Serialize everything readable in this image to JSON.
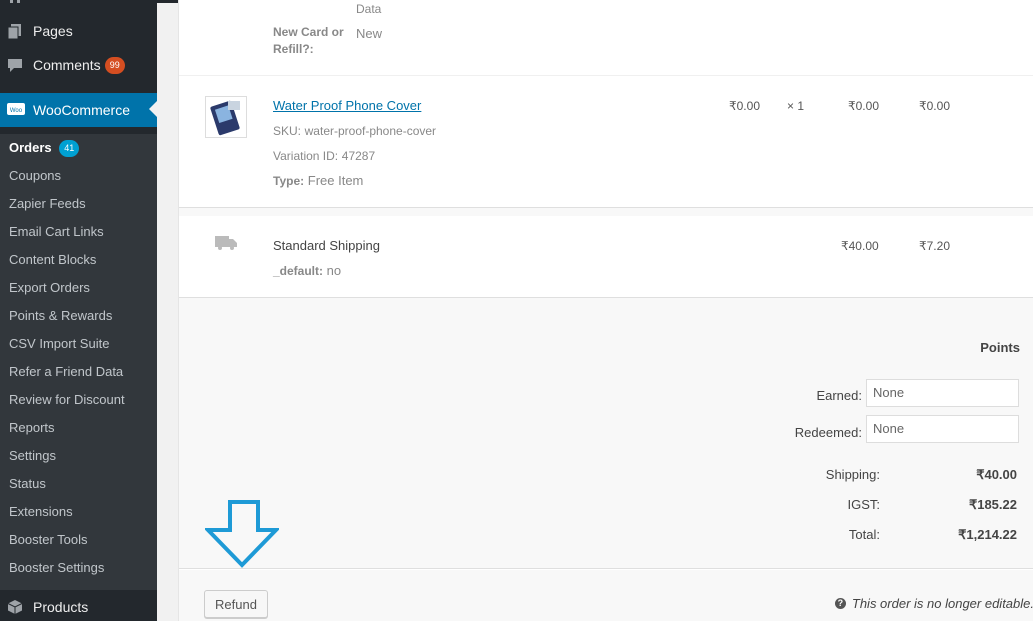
{
  "sidebar": {
    "pages_label": "Pages",
    "comments_label": "Comments",
    "comments_count": "99",
    "woocommerce_label": "WooCommerce",
    "woo_logo_text": "Woo",
    "submenu": {
      "orders_label": "Orders",
      "orders_count": "41",
      "items": [
        "Coupons",
        "Zapier Feeds",
        "Email Cart Links",
        "Content Blocks",
        "Export Orders",
        "Points & Rewards",
        "CSV Import Suite",
        "Refer a Friend Data",
        "Review for Discount",
        "Reports",
        "Settings",
        "Status",
        "Extensions",
        "Booster Tools",
        "Booster Settings"
      ]
    },
    "products_label": "Products"
  },
  "order_items": {
    "partial_meta": {
      "value_top": "Data",
      "label": "New Card or Refill?:",
      "value": "New"
    },
    "product": {
      "name": "Water Proof Phone Cover",
      "sku_label": "SKU:",
      "sku": "water-proof-phone-cover",
      "variation_label": "Variation ID:",
      "variation_id": "47287",
      "type_label": "Type:",
      "type": "Free Item",
      "cost": "₹0.00",
      "qty": "× 1",
      "total": "₹0.00",
      "tax": "₹0.00"
    },
    "shipping": {
      "method": "Standard Shipping",
      "meta_label": "_default:",
      "meta_value": "no",
      "total": "₹40.00",
      "tax": "₹7.20"
    }
  },
  "totals": {
    "points_heading": "Points",
    "earned_label": "Earned:",
    "earned_value": "None",
    "redeemed_label": "Redeemed:",
    "redeemed_value": "None",
    "shipping_label": "Shipping:",
    "shipping_value": "₹40.00",
    "igst_label": "IGST:",
    "igst_value": "₹185.22",
    "total_label": "Total:",
    "total_value": "₹1,214.22"
  },
  "footer": {
    "refund_label": "Refund",
    "note": "This order is no longer editable."
  },
  "colors": {
    "sidebar_bg": "#23282d",
    "submenu_bg": "#32373c",
    "active_bg": "#0073aa",
    "arrow_stroke": "#1e9ad6"
  }
}
